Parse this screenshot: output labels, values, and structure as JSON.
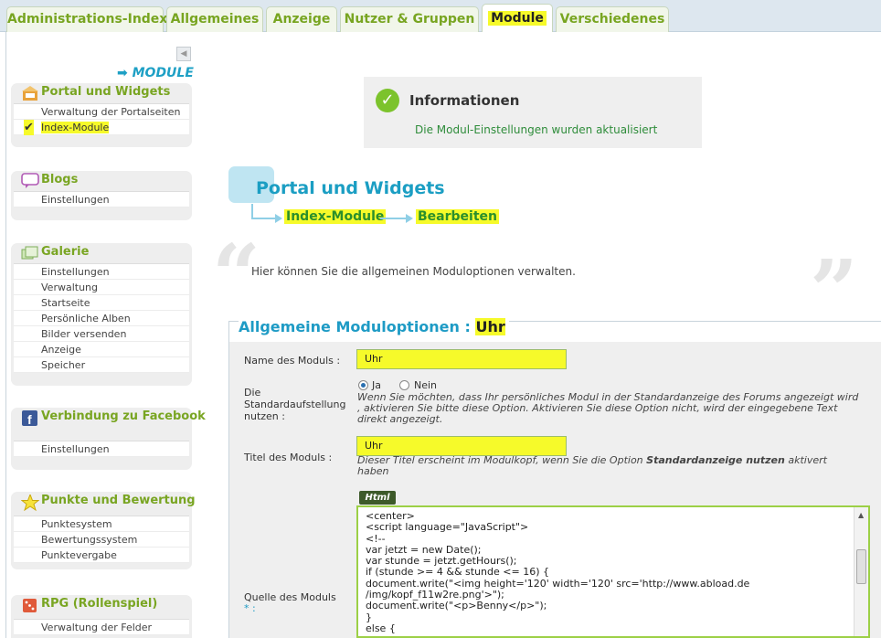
{
  "tabs": [
    {
      "label": "Administrations-Index"
    },
    {
      "label": "Allgemeines"
    },
    {
      "label": "Anzeige"
    },
    {
      "label": "Nutzer & Gruppen"
    },
    {
      "label": "Module"
    },
    {
      "label": "Verschiedenes"
    }
  ],
  "active_tab": "Module",
  "sidebar": {
    "section_heading": "➡ MODULE",
    "collapse_icon": "◀",
    "boxes": [
      {
        "title": "Portal und Widgets",
        "icon": "portal-icon",
        "items": [
          {
            "label": "Verwaltung der Portalseiten"
          },
          {
            "label": "Index-Module"
          }
        ]
      },
      {
        "title": "Blogs",
        "icon": "speech-bubble-icon",
        "items": [
          {
            "label": "Einstellungen"
          }
        ]
      },
      {
        "title": "Galerie",
        "icon": "photos-icon",
        "items": [
          {
            "label": "Einstellungen"
          },
          {
            "label": "Verwaltung"
          },
          {
            "label": "Startseite"
          },
          {
            "label": "Persönliche Alben"
          },
          {
            "label": "Bilder versenden"
          },
          {
            "label": "Anzeige"
          },
          {
            "label": "Speicher"
          }
        ]
      },
      {
        "title": "Verbindung zu Facebook",
        "icon": "facebook-icon",
        "items": [
          {
            "label": "Einstellungen"
          }
        ]
      },
      {
        "title": "Punkte und Bewertung",
        "icon": "star-icon",
        "items": [
          {
            "label": "Punktesystem"
          },
          {
            "label": "Bewertungssystem"
          },
          {
            "label": "Punktevergabe"
          }
        ]
      },
      {
        "title": "RPG (Rollenspiel)",
        "icon": "dice-icon",
        "items": [
          {
            "label": "Verwaltung der Felder"
          }
        ]
      }
    ],
    "selected_item": "Index-Module"
  },
  "info": {
    "title": "Informationen",
    "message": "Die Modul-Einstellungen wurden aktualisiert",
    "icon": "checkmark-icon"
  },
  "main": {
    "title": "Portal und Widgets",
    "breadcrumb": [
      "Index-Module",
      "Bearbeiten"
    ],
    "intro": "Hier können Sie die allgemeinen Moduloptionen verwalten.",
    "quote_open": "“",
    "quote_close": "”"
  },
  "form": {
    "title_prefix": "Allgemeine Moduloptionen : ",
    "title_value": "Uhr",
    "name_label": "Name des Moduls :",
    "name_value": "Uhr",
    "default_label": "Die Standardaufstellung nutzen :",
    "radio_yes": "Ja",
    "radio_no": "Nein",
    "radio_selected": "Ja",
    "default_hint": "Wenn Sie möchten, dass Ihr persönliches Modul in der Standardanzeige des Forums angezeigt wird , aktivieren Sie bitte diese Option. Aktivieren Sie diese Option nicht, wird der eingegebene Text direkt angezeigt.",
    "title_label": "Titel des Moduls :",
    "title_field_value": "Uhr",
    "title_hint_pre": "Dieser Titel erscheint im Modulkopf, wenn Sie die Option ",
    "title_hint_bold": "Standardanzeige nutzen",
    "title_hint_post": " aktivert haben",
    "html_button": "Html",
    "source_label": "Quelle des Moduls",
    "source_required": "* :",
    "source_code": "<center>\n<script language=\"JavaScript\">\n<!--\nvar jetzt = new Date();\nvar stunde = jetzt.getHours();\nif (stunde >= 4 && stunde <= 16) {\ndocument.write(\"<img height='120' width='120' src='http://www.abload.de\n/img/kopf_f11w2re.png'>\");\ndocument.write(\"<p>Benny</p>\");\n}\nelse {"
  },
  "colors": {
    "accent_green": "#79a522",
    "accent_blue": "#1b9ec3",
    "highlight": "#f6fa2a"
  }
}
